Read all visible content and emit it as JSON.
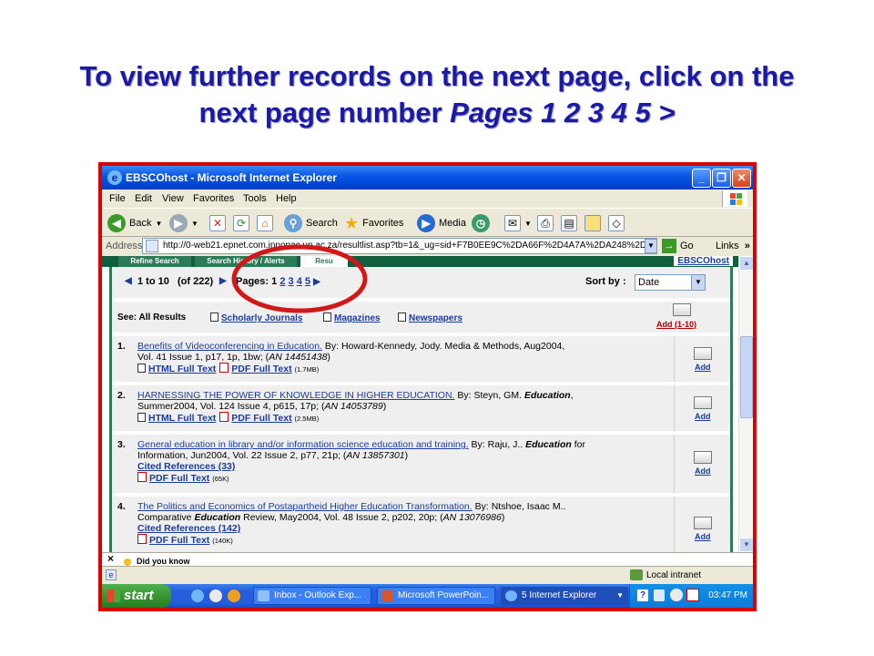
{
  "slide": {
    "title_line1": "To view further records on the next page, click on the",
    "title_line2_plain": "next page number ",
    "title_line2_italic": "Pages 1 2 3 4 5 >"
  },
  "colors": {
    "title": "#1a1aa6",
    "highlight_circle": "#d01818",
    "link": "#1a3c9c",
    "ebsco_green": "#2b7a58",
    "frame_red": "#d80000"
  },
  "window": {
    "title": "EBSCOhost - Microsoft Internet Explorer",
    "menu": [
      "File",
      "Edit",
      "View",
      "Favorites",
      "Tools",
      "Help"
    ],
    "toolbar": {
      "back": "Back",
      "search": "Search",
      "favorites": "Favorites",
      "media": "Media"
    },
    "address": {
      "label": "Address",
      "url": "http://0-web21.epnet.com.innopac.up.ac.za/resultlist.asp?tb=1&_ug=sid+F7B0EE9C%2DA66F%2D4A7A%2DA248%2DC7E",
      "go": "Go",
      "links": "Links"
    }
  },
  "ebsco": {
    "tabs": [
      "Refine Search",
      "Search History / Alerts",
      "Resu"
    ],
    "brand": "EBSCOhost",
    "nav": {
      "range": "1 to 10",
      "total": "(of 222)",
      "pages_label": "Pages: 1",
      "pages": [
        "2",
        "3",
        "4",
        "5"
      ],
      "sort_label": "Sort by :",
      "sort_value": "Date"
    },
    "categories": {
      "label": "See: All Results",
      "items": [
        "Scholarly Journals",
        "Magazines",
        "Newspapers"
      ],
      "add_range": "Add (1-10)"
    },
    "records": [
      {
        "num": "1.",
        "title": "Benefits of Videoconferencing in Education.",
        "line1_rest": " By: Howard-Kennedy, Jody. Media & Methods, Aug2004,",
        "line2_pre": "Vol. 41 Issue 1, p17, 1p, 1bw; (",
        "an": "AN 14451438",
        "line2_post": ")",
        "html": "HTML Full Text",
        "pdf": "PDF Full Text",
        "size": "(1.7MB)",
        "add": "Add"
      },
      {
        "num": "2.",
        "title": "HARNESSING THE POWER OF KNOWLEDGE IN HIGHER EDUCATION.",
        "line1_rest": " By: Steyn, GM. ",
        "line1_bold": "Education",
        "line1_tail": ",",
        "line2_pre": "Summer2004, Vol. 124 Issue 4, p615, 17p; (",
        "an": "AN 14053789",
        "line2_post": ")",
        "html": "HTML Full Text",
        "pdf": "PDF Full Text",
        "size": "(2.5MB)",
        "add": "Add"
      },
      {
        "num": "3.",
        "title": "General education in library and/or information science education and training.",
        "line1_rest": " By: Raju, J.. ",
        "line1_bold": "Education",
        "line1_tail": " for",
        "line2_pre": "Information, Jun2004, Vol. 22 Issue 2, p77, 21p; (",
        "an": "AN 13857301",
        "line2_post": ")",
        "cited": "Cited References (33)",
        "pdf": "PDF Full Text",
        "size": "(65K)",
        "add": "Add"
      },
      {
        "num": "4.",
        "title": "The Politics and Economics of Postapartheid Higher Education Transformation.",
        "line1_rest": " By: Ntshoe, Isaac M..",
        "line2_pre": "Comparative ",
        "line2_bold": "Education",
        "line2_mid": " Review, May2004, Vol. 48 Issue 2, p202, 20p; (",
        "an": "AN 13076986",
        "line2_post": ")",
        "cited": "Cited References (142)",
        "pdf": "PDF Full Text",
        "size": "(140K)",
        "add": "Add"
      }
    ]
  },
  "bottom": {
    "close_x": "×",
    "did_you_know": "Did you know",
    "status_zone": "Local intranet"
  },
  "taskbar": {
    "start": "start",
    "tasks": [
      "Inbox - Outlook Exp...",
      "Microsoft PowerPoin...",
      "5 Internet Explorer"
    ],
    "clock": "03:47 PM"
  }
}
